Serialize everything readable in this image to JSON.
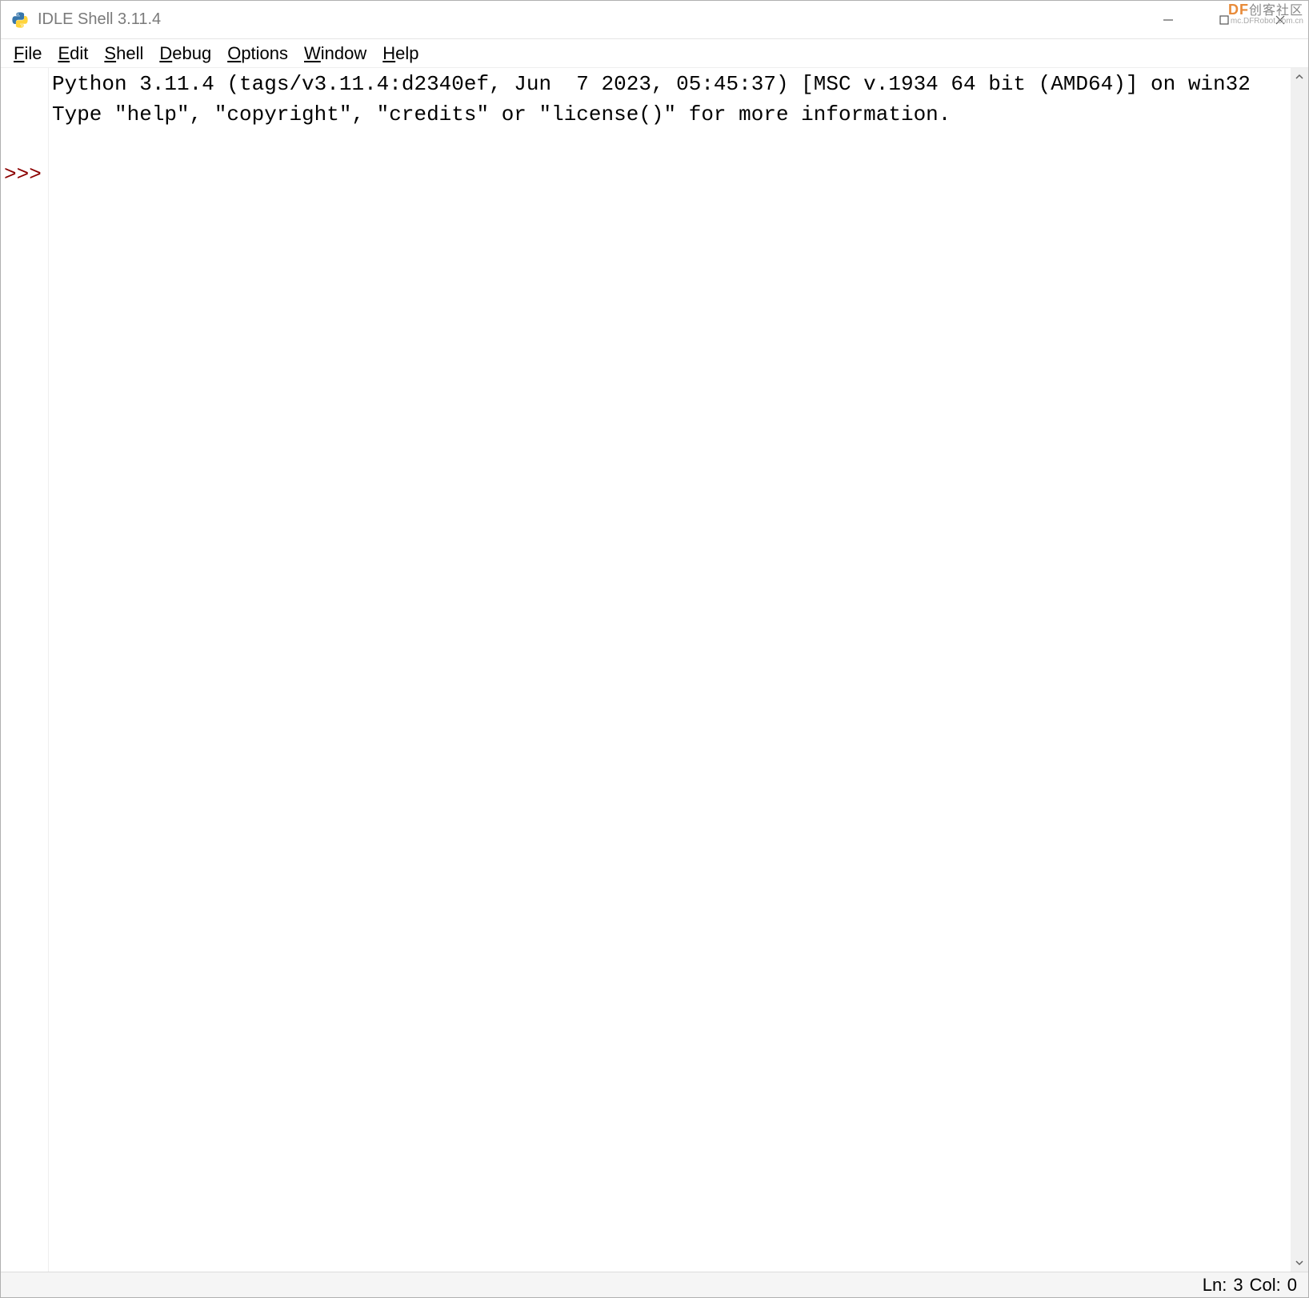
{
  "window": {
    "title": "IDLE Shell 3.11.4"
  },
  "menubar": {
    "items": [
      {
        "label": "File",
        "underline_index": 0
      },
      {
        "label": "Edit",
        "underline_index": 0
      },
      {
        "label": "Shell",
        "underline_index": 0
      },
      {
        "label": "Debug",
        "underline_index": 0
      },
      {
        "label": "Options",
        "underline_index": 0
      },
      {
        "label": "Window",
        "underline_index": 0
      },
      {
        "label": "Help",
        "underline_index": 0
      }
    ]
  },
  "shell": {
    "banner_line1": "Python 3.11.4 (tags/v3.11.4:d2340ef, Jun  7 2023, 05:45:37) [MSC v.1934 64 bit (AMD64)] on win32",
    "banner_line2": "Type \"help\", \"copyright\", \"credits\" or \"license()\" for more information.",
    "prompt": ">>>",
    "gutter_blank": " "
  },
  "statusbar": {
    "ln_label": "Ln:",
    "ln_value": "3",
    "col_label": "Col:",
    "col_value": "0"
  },
  "watermark": {
    "line1_prefix": "DF",
    "line1_suffix": "创客社区",
    "line2": "mc.DFRobot.com.cn"
  }
}
